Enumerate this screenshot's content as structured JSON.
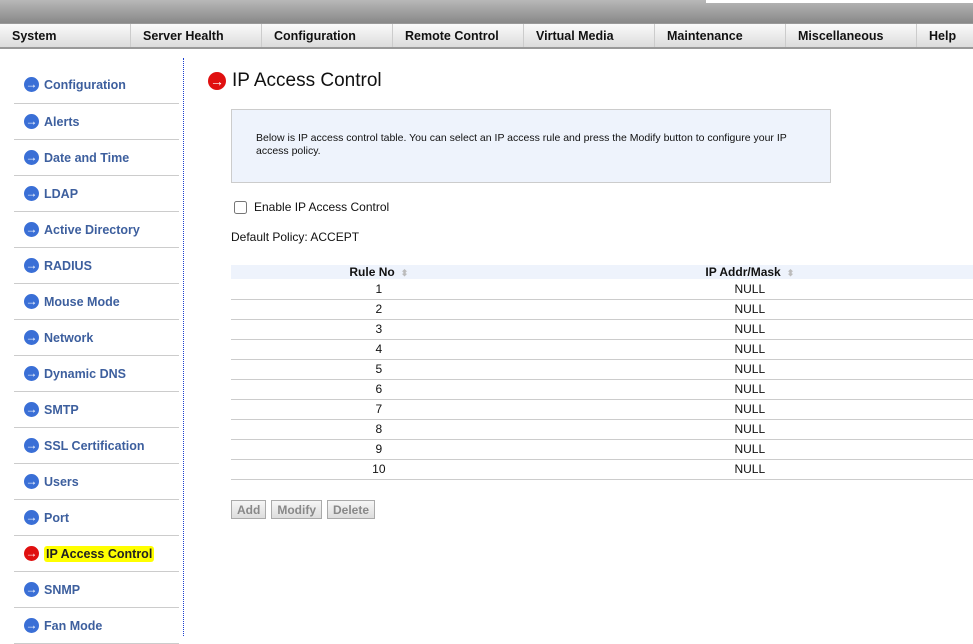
{
  "nav": [
    "System",
    "Server Health",
    "Configuration",
    "Remote Control",
    "Virtual Media",
    "Maintenance",
    "Miscellaneous",
    "Help"
  ],
  "sidebar": [
    "Configuration",
    "Alerts",
    "Date and Time",
    "LDAP",
    "Active Directory",
    "RADIUS",
    "Mouse Mode",
    "Network",
    "Dynamic DNS",
    "SMTP",
    "SSL Certification",
    "Users",
    "Port",
    "IP Access Control",
    "SNMP",
    "Fan Mode"
  ],
  "active_index": 13,
  "page_title": "IP Access Control",
  "info_text": "Below is IP access control table. You can select an IP access rule and press the Modify button to configure your IP access policy.",
  "enable_label": "Enable IP Access Control",
  "enable_checked": false,
  "default_policy": "Default Policy: ACCEPT",
  "table": {
    "headers": [
      "Rule No",
      "IP Addr/Mask"
    ],
    "rows": [
      [
        "1",
        "NULL"
      ],
      [
        "2",
        "NULL"
      ],
      [
        "3",
        "NULL"
      ],
      [
        "4",
        "NULL"
      ],
      [
        "5",
        "NULL"
      ],
      [
        "6",
        "NULL"
      ],
      [
        "7",
        "NULL"
      ],
      [
        "8",
        "NULL"
      ],
      [
        "9",
        "NULL"
      ],
      [
        "10",
        "NULL"
      ]
    ]
  },
  "buttons": {
    "add": "Add",
    "modify": "Modify",
    "delete": "Delete"
  },
  "icons": {
    "arrow": "→",
    "sort": "⬍"
  },
  "colors": {
    "accent": "#3a6fd6",
    "active": "#e01010",
    "highlight": "#ffff00"
  }
}
